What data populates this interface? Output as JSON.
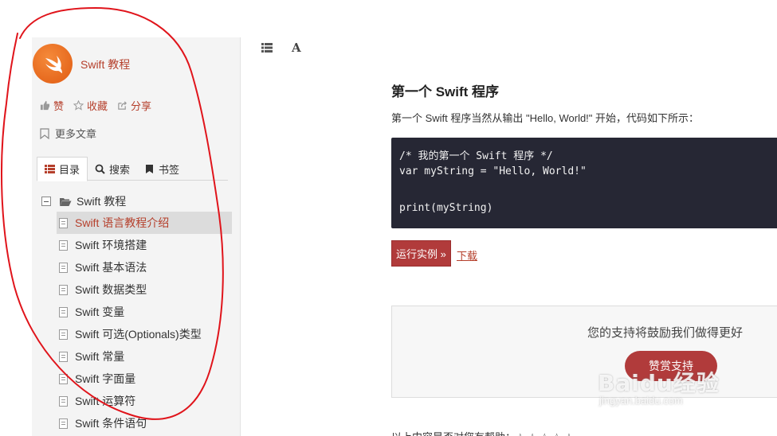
{
  "sidebar": {
    "site_title": "Swift 教程",
    "actions": {
      "like": "赞",
      "collect": "收藏",
      "share": "分享"
    },
    "more_articles": "更多文章",
    "tabs": [
      "目录",
      "搜索",
      "书签"
    ],
    "tree_root": "Swift 教程",
    "items": [
      "Swift 语言教程介绍",
      "Swift 环境搭建",
      "Swift 基本语法",
      "Swift 数据类型",
      "Swift 变量",
      "Swift 可选(Optionals)类型",
      "Swift 常量",
      "Swift 字面量",
      "Swift 运算符",
      "Swift 条件语句"
    ],
    "active_index": 0
  },
  "toolbar": {
    "font_label": "A"
  },
  "main": {
    "heading": "第一个 Swift 程序",
    "intro": "第一个 Swift 程序当然从输出 \"Hello, World!\" 开始，代码如下所示：",
    "code_lines": [
      "/* 我的第一个 Swift 程序 */",
      "var myString = \"Hello, World!\"",
      "",
      "print(myString)"
    ],
    "run_button": "运行实例 »",
    "download_link": "下载",
    "support_text": "您的支持将鼓励我们做得更好",
    "donate_button": "赞赏支持",
    "bottom_text": "以上内容是否对您有帮助：☆ ☆ ☆ ☆ ☆"
  },
  "watermark": {
    "main": "Baidu经验",
    "sub": "jingyan.baidu.com"
  },
  "colors": {
    "accent": "#b53f2b",
    "code_bg": "#262734",
    "annotation": "#e0141b"
  }
}
